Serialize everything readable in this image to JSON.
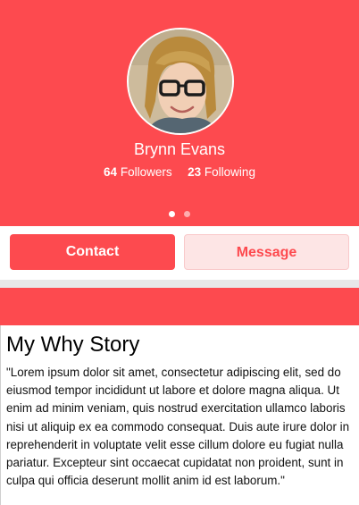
{
  "profile": {
    "name": "Brynn Evans",
    "followers_count": "64",
    "followers_label": "Followers",
    "following_count": "23",
    "following_label": "Following",
    "page_indicator": {
      "total": 2,
      "active": 1
    }
  },
  "actions": {
    "contact_label": "Contact",
    "message_label": "Message"
  },
  "story": {
    "title": "My Why Story",
    "body": "\"Lorem ipsum dolor sit amet, consectetur adipiscing elit, sed do eiusmod tempor incididunt ut labore et dolore magna aliqua. Ut enim ad minim veniam, quis nostrud exercitation ullamco laboris nisi ut aliquip ex ea commodo consequat. Duis aute irure dolor in reprehenderit in voluptate velit esse cillum dolore eu fugiat nulla pariatur. Excepteur sint occaecat cupidatat non proident, sunt in culpa qui officia deserunt mollit anim id est laborum.\""
  },
  "colors": {
    "accent": "#fd4a4f",
    "message_bg": "#fde5e5",
    "separator": "#e8e8e8"
  }
}
